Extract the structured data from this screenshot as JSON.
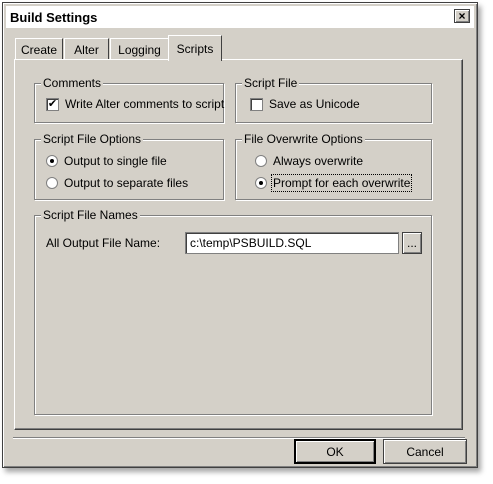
{
  "window": {
    "title": "Build Settings",
    "close_glyph": "×"
  },
  "tabs": [
    {
      "label": "Create"
    },
    {
      "label": "Alter"
    },
    {
      "label": "Logging"
    },
    {
      "label": "Scripts",
      "active": true
    }
  ],
  "comments": {
    "legend": "Comments",
    "write_alter_label": "Write Alter comments to script",
    "write_alter_checked": true,
    "check_glyph": "✔"
  },
  "script_file": {
    "legend": "Script File",
    "save_unicode_label": "Save as Unicode",
    "save_unicode_checked": false
  },
  "script_file_options": {
    "legend": "Script File Options",
    "options": [
      {
        "label": "Output to single file",
        "selected": true
      },
      {
        "label": "Output to separate files",
        "selected": false
      }
    ]
  },
  "file_overwrite_options": {
    "legend": "File Overwrite Options",
    "options": [
      {
        "label": "Always overwrite",
        "selected": false
      },
      {
        "label": "Prompt for each overwrite",
        "selected": true
      }
    ]
  },
  "script_file_names": {
    "legend": "Script File Names",
    "all_output_label": "All Output File Name:",
    "all_output_value": "c:\\temp\\PSBUILD.SQL",
    "browse_label": "..."
  },
  "buttons": {
    "ok": "OK",
    "cancel": "Cancel"
  }
}
